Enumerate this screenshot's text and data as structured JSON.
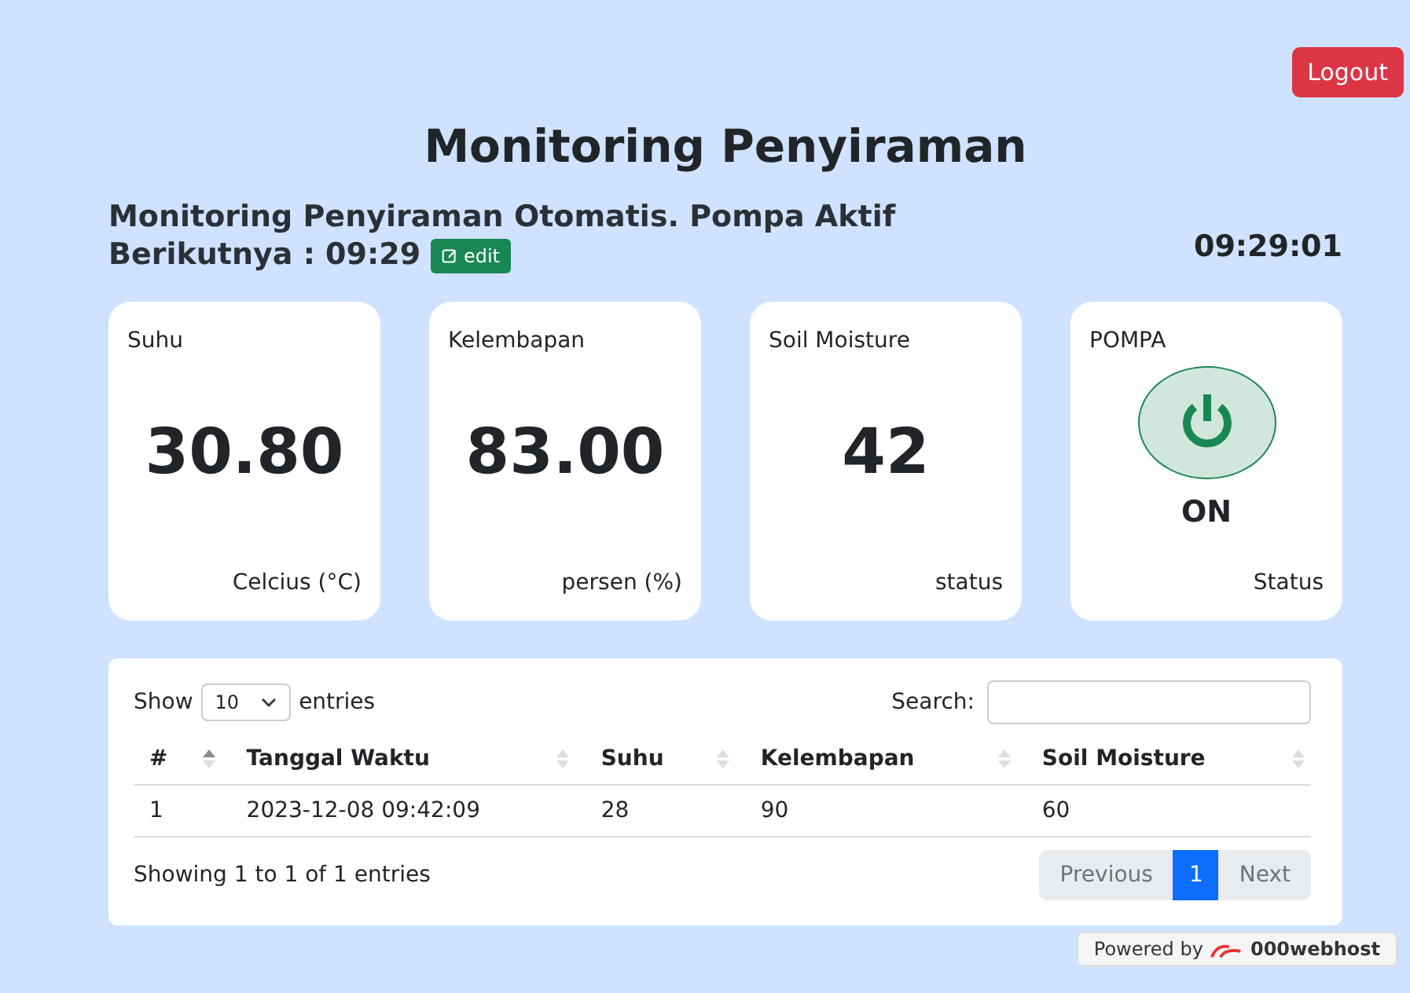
{
  "logout_button": "Logout",
  "title": "Monitoring Penyiraman",
  "subtitle": "Monitoring Penyiraman Otomatis. Pompa Aktif Berikutnya : 09:29",
  "edit_button": "edit",
  "clock": "09:29:01",
  "cards": [
    {
      "kind": "value",
      "label": "Suhu",
      "value": "30.80",
      "unit": "Celcius (°C)"
    },
    {
      "kind": "value",
      "label": "Kelembapan",
      "value": "83.00",
      "unit": "persen (%)"
    },
    {
      "kind": "value",
      "label": "Soil Moisture",
      "value": "42",
      "unit": "status"
    },
    {
      "kind": "pump",
      "label": "POMPA",
      "on": true,
      "value": "ON",
      "unit": "Status"
    }
  ],
  "table": {
    "show_label": "Show",
    "page_size": "10",
    "entries_label": "entries",
    "search_label": "Search:",
    "columns": [
      {
        "label": "#",
        "sorted": true
      },
      {
        "label": "Tanggal Waktu",
        "sorted": false
      },
      {
        "label": "Suhu",
        "sorted": false
      },
      {
        "label": "Kelembapan",
        "sorted": false
      },
      {
        "label": "Soil Moisture",
        "sorted": false
      }
    ],
    "rows": [
      [
        "1",
        "2023-12-08 09:42:09",
        "28",
        "90",
        "60"
      ]
    ],
    "info": "Showing 1 to 1 of 1 entries",
    "pagination": [
      {
        "kind": "prev",
        "label": "Previous",
        "selected": false
      },
      {
        "kind": "page",
        "label": "1",
        "selected": true
      },
      {
        "kind": "next",
        "label": "Next",
        "selected": false
      }
    ]
  },
  "footer": {
    "powered": "Powered by",
    "host": "000webhost"
  }
}
